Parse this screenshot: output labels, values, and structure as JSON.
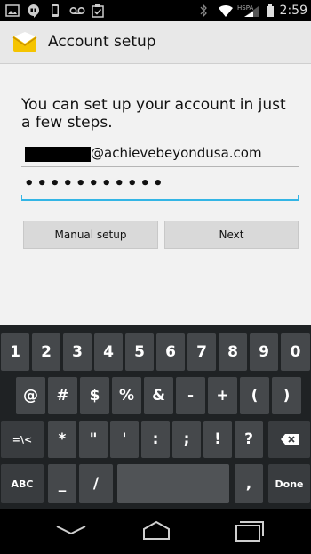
{
  "status_bar": {
    "time": "2:59",
    "network": "HSPA",
    "left_icons": [
      "picture-icon",
      "hangouts-icon",
      "phone-icon",
      "voicemail-icon",
      "clipboard-check-icon"
    ],
    "right_icons": [
      "bluetooth-icon",
      "wifi-icon",
      "signal-icon",
      "battery-icon"
    ]
  },
  "action_bar": {
    "title": "Account setup",
    "icon": "email-envelope-icon"
  },
  "form": {
    "instructions": "You can set up your account in just a few steps.",
    "email_value": "@achievebeyondusa.com",
    "password_value": "•••••••••••",
    "manual_setup_label": "Manual setup",
    "next_label": "Next"
  },
  "keyboard": {
    "row1": [
      "1",
      "2",
      "3",
      "4",
      "5",
      "6",
      "7",
      "8",
      "9",
      "0"
    ],
    "row2": [
      "@",
      "#",
      "$",
      "%",
      "&",
      "-",
      "+",
      "(",
      ")"
    ],
    "row3": [
      "=\\<",
      "*",
      "\"",
      "'",
      ":",
      ";",
      "!",
      "?"
    ],
    "row4_abc": "ABC",
    "row4_underscore": "_",
    "row4_slash": "/",
    "row4_comma": ",",
    "row4_period": ".",
    "row4_done": "Done"
  },
  "colors": {
    "accent": "#33b5e5",
    "action_bar": "#e8e8e8",
    "keyboard_bg": "#1f2224",
    "key_bg": "#45484b"
  }
}
